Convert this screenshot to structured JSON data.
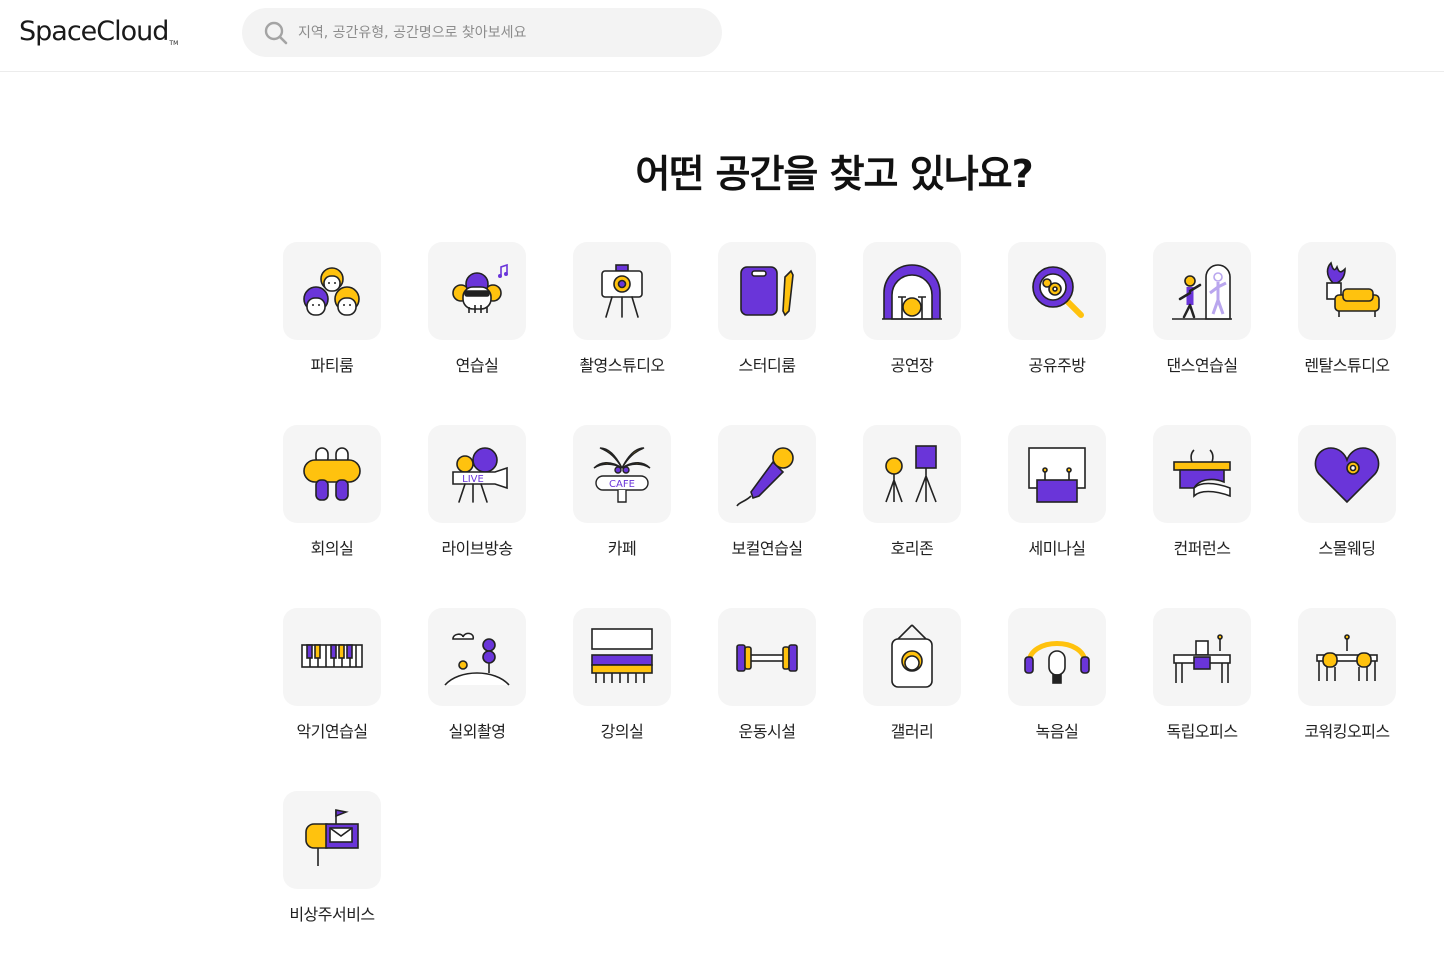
{
  "header": {
    "logo_text": "SpaceCloud",
    "logo_tm": "TM",
    "search_placeholder": "지역, 공간유형, 공간명으로 찾아보세요",
    "search_value": ""
  },
  "main": {
    "title": "어떤 공간을 찾고 있나요?"
  },
  "colors": {
    "purple": "#6a35d9",
    "yellow": "#ffc20e",
    "tile_bg": "#f5f5f5",
    "search_bg": "#f3f3f3"
  },
  "categories": [
    {
      "label": "파티룸",
      "icon": "party-room-icon"
    },
    {
      "label": "연습실",
      "icon": "practice-room-icon"
    },
    {
      "label": "촬영스튜디오",
      "icon": "photo-studio-icon"
    },
    {
      "label": "스터디룸",
      "icon": "study-room-icon"
    },
    {
      "label": "공연장",
      "icon": "concert-hall-icon"
    },
    {
      "label": "공유주방",
      "icon": "shared-kitchen-icon"
    },
    {
      "label": "댄스연습실",
      "icon": "dance-studio-icon"
    },
    {
      "label": "렌탈스튜디오",
      "icon": "rental-studio-icon"
    },
    {
      "label": "회의실",
      "icon": "meeting-room-icon"
    },
    {
      "label": "라이브방송",
      "icon": "live-broadcast-icon",
      "icon_text": "LIVE"
    },
    {
      "label": "카페",
      "icon": "cafe-icon",
      "icon_text": "CAFE"
    },
    {
      "label": "보컬연습실",
      "icon": "vocal-room-icon"
    },
    {
      "label": "호리존",
      "icon": "horizon-studio-icon"
    },
    {
      "label": "세미나실",
      "icon": "seminar-room-icon"
    },
    {
      "label": "컨퍼런스",
      "icon": "conference-icon"
    },
    {
      "label": "스몰웨딩",
      "icon": "small-wedding-icon"
    },
    {
      "label": "악기연습실",
      "icon": "instrument-room-icon"
    },
    {
      "label": "실외촬영",
      "icon": "outdoor-shoot-icon"
    },
    {
      "label": "강의실",
      "icon": "lecture-room-icon"
    },
    {
      "label": "운동시설",
      "icon": "fitness-icon"
    },
    {
      "label": "갤러리",
      "icon": "gallery-icon"
    },
    {
      "label": "녹음실",
      "icon": "recording-studio-icon"
    },
    {
      "label": "독립오피스",
      "icon": "private-office-icon"
    },
    {
      "label": "코워킹오피스",
      "icon": "coworking-office-icon"
    },
    {
      "label": "비상주서비스",
      "icon": "virtual-office-icon"
    }
  ]
}
